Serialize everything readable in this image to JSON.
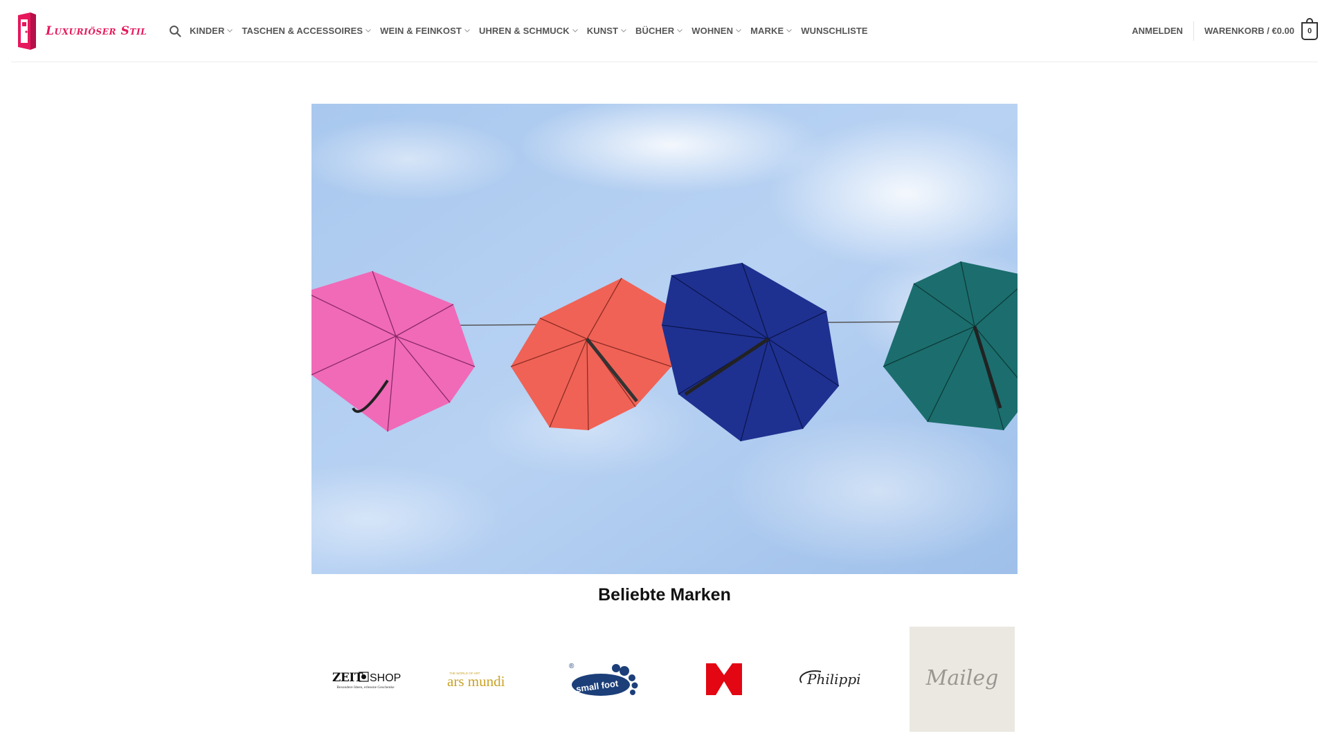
{
  "header": {
    "logo_text": "Luxuriöser Stil",
    "nav": [
      {
        "label": "KINDER",
        "has_dropdown": true
      },
      {
        "label": "TASCHEN & ACCESSOIRES",
        "has_dropdown": true
      },
      {
        "label": "WEIN & FEINKOST",
        "has_dropdown": true
      },
      {
        "label": "UHREN & SCHMUCK",
        "has_dropdown": true
      },
      {
        "label": "KUNST",
        "has_dropdown": true
      },
      {
        "label": "BÜCHER",
        "has_dropdown": true
      },
      {
        "label": "WOHNEN",
        "has_dropdown": true
      },
      {
        "label": "MARKE",
        "has_dropdown": true
      },
      {
        "label": "WUNSCHLISTE",
        "has_dropdown": false
      }
    ],
    "login_label": "ANMELDEN",
    "cart_label": "WARENKORB / €0.00",
    "cart_count": "0",
    "icons": {
      "search": "search-icon",
      "cart": "cart-icon",
      "chevron": "chevron-down-icon"
    }
  },
  "hero": {
    "image": "umbrellas-against-sky"
  },
  "brands": {
    "title": "Beliebte Marken",
    "items": [
      {
        "name": "ZEIT SHOP",
        "word1": "ZEIT",
        "word2": "SHOP",
        "tagline": "Besondere Ideen, erlesene Geschenke"
      },
      {
        "name": "ars mundi",
        "small": "THE WORLD OF ART",
        "word": "ars mundi"
      },
      {
        "name": "small foot",
        "word": "small foot",
        "mark": "®"
      },
      {
        "name": "K"
      },
      {
        "name": "Philippi",
        "word": "Philippi"
      },
      {
        "name": "Maileg",
        "word": "Maileg"
      }
    ]
  },
  "colors": {
    "brand": "#e6185b",
    "nav_text": "#555555",
    "smallfoot_blue": "#1c3f79",
    "k_red": "#e30613",
    "arsmundi_gold": "#c9a227"
  }
}
